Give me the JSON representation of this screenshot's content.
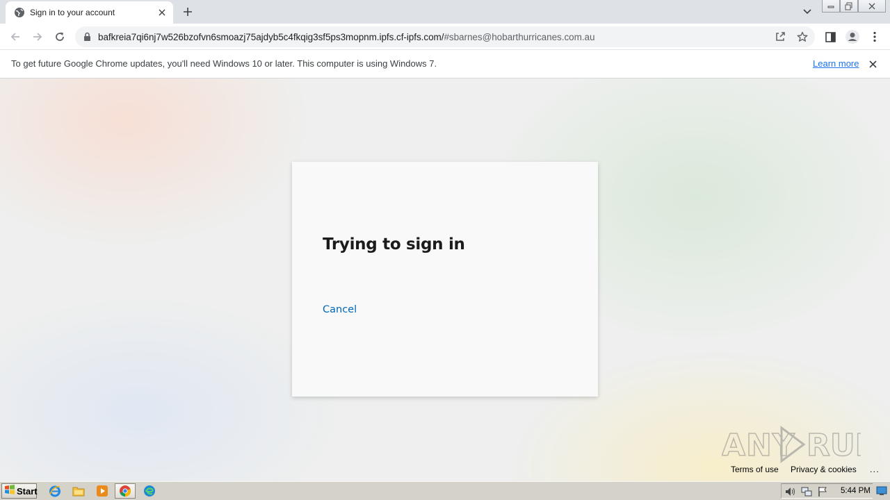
{
  "browser": {
    "tab": {
      "title": "Sign in to your account",
      "favicon": "globe-icon"
    },
    "toolbar": {
      "url_main": "bafkreia7qi6nj7w526bzofvn6smoazj75ajdyb5c4fkqig3sf5ps3mopnm.ipfs.cf-ipfs.com/",
      "url_fragment": "#sbarnes@hobarthurricanes.com.au"
    },
    "infobar": {
      "message": "To get future Google Chrome updates, you'll need Windows 10 or later. This computer is using Windows 7.",
      "link": "Learn more"
    }
  },
  "page": {
    "heading": "Trying to sign in",
    "cancel": "Cancel",
    "footer": {
      "terms": "Terms of use",
      "privacy": "Privacy & cookies",
      "more": ". . ."
    },
    "watermark": "ANY RUN"
  },
  "taskbar": {
    "start_label": "Start",
    "clock": "5:44 PM",
    "pinned": [
      "internet-explorer-icon",
      "file-explorer-icon",
      "media-player-icon",
      "chrome-icon",
      "edge-icon"
    ]
  },
  "colors": {
    "link_blue": "#1a73e8",
    "ms_blue": "#0067b8",
    "tabstrip": "#dee1e6"
  }
}
